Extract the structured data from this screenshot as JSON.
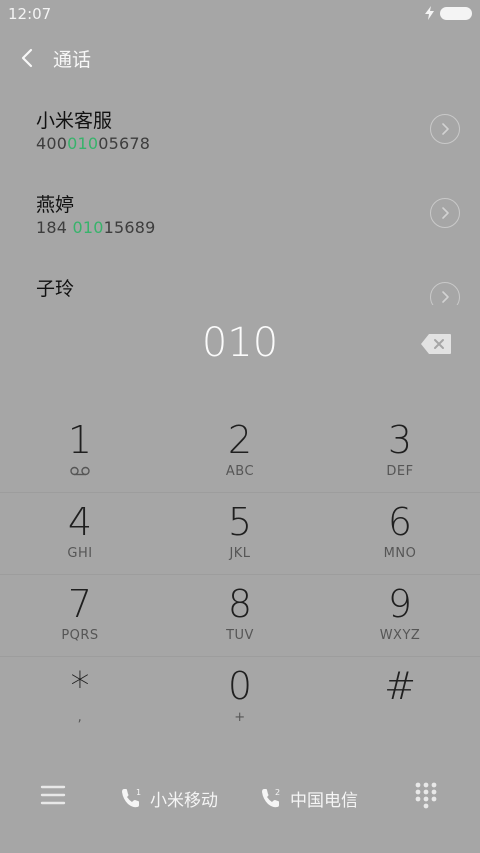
{
  "status_bar": {
    "time": "12:07"
  },
  "header": {
    "title": "通话"
  },
  "contacts": [
    {
      "name": "小米客服",
      "number_pre": "400",
      "number_match": "010",
      "number_post": "05678"
    },
    {
      "name": "燕婷",
      "number_pre": "184 ",
      "number_match": "010",
      "number_post": "15689"
    },
    {
      "name": "子玲"
    }
  ],
  "dialer": {
    "digits": "010"
  },
  "keypad": {
    "keys": [
      {
        "digit": "1",
        "sub": ""
      },
      {
        "digit": "2",
        "sub": "ABC"
      },
      {
        "digit": "3",
        "sub": "DEF"
      },
      {
        "digit": "4",
        "sub": "GHI"
      },
      {
        "digit": "5",
        "sub": "JKL"
      },
      {
        "digit": "6",
        "sub": "MNO"
      },
      {
        "digit": "7",
        "sub": "PQRS"
      },
      {
        "digit": "8",
        "sub": "TUV"
      },
      {
        "digit": "9",
        "sub": "WXYZ"
      },
      {
        "digit": "*",
        "sub": ","
      },
      {
        "digit": "0",
        "sub": "+"
      },
      {
        "digit": "#",
        "sub": ""
      }
    ]
  },
  "bottom_bar": {
    "sim1_label": "小米移动",
    "sim1_index": "1",
    "sim2_label": "中国电信",
    "sim2_index": "2"
  },
  "icons": {
    "back": "chevron-left-icon",
    "detail": "chevron-right-circle-icon",
    "backspace": "backspace-icon",
    "voicemail": "voicemail-icon",
    "menu": "menu-icon",
    "sim_call": "phone-icon",
    "dialpad": "dialpad-icon",
    "charging": "lightning-icon",
    "battery": "battery-icon"
  },
  "colors": {
    "highlight": "#37b36b",
    "background": "#a6a6a6"
  }
}
